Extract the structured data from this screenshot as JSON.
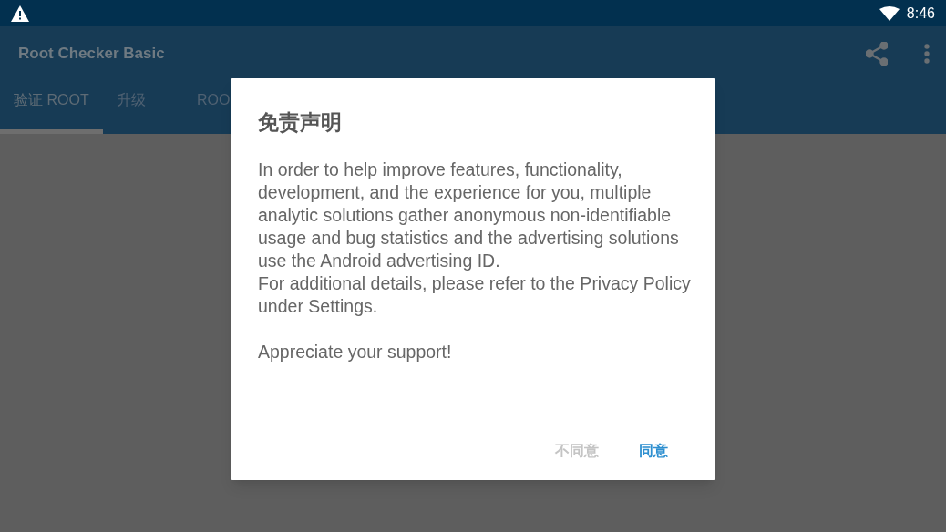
{
  "status_bar": {
    "time": "8:46"
  },
  "app_bar": {
    "title": "Root Checker Basic"
  },
  "tabs": [
    {
      "label": "验证 ROOT",
      "selected": true
    },
    {
      "label": "升级",
      "selected": false
    },
    {
      "label": "ROO",
      "selected": false
    }
  ],
  "dialog": {
    "title": "免责声明",
    "paragraphs": [
      "In order to help improve features, functionality, development, and the experience for you, multiple analytic solutions gather anonymous non-identifiable usage and bug statistics and the advertising solutions use the Android advertising ID.",
      "For additional details, please refer to the Privacy Policy under Settings.",
      "Appreciate your support!"
    ],
    "buttons": [
      {
        "label": "不同意",
        "disabled": true
      },
      {
        "label": "同意",
        "disabled": false
      }
    ]
  }
}
